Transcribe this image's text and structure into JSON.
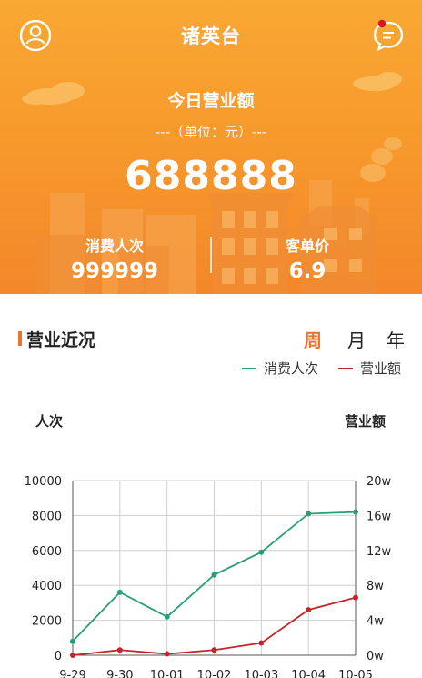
{
  "header": {
    "title": "诸英台"
  },
  "summary": {
    "revenue_label": "今日营业额",
    "unit_label": "---（单位：元）---",
    "revenue_value": "688888",
    "customers_label": "消费人次",
    "customers_value": "999999",
    "avg_price_label": "客单价",
    "avg_price_value": "6.9"
  },
  "section": {
    "title": "营业近况",
    "periods": [
      "周",
      "月",
      "年"
    ],
    "active_period": "周"
  },
  "colors": {
    "accent": "#f0732a",
    "series_customers": "#2a9d79",
    "series_revenue": "#c0262a"
  },
  "icons": {
    "profile": "user-circle-icon",
    "messages": "chat-bubble-icon"
  },
  "chart_data": {
    "type": "line",
    "x": [
      "9-29",
      "9-30",
      "10-01",
      "10-02",
      "10-03",
      "10-04",
      "10-05"
    ],
    "ylabel": "人次",
    "y2label": "营业额",
    "ylim": [
      0,
      10000
    ],
    "yticks": [
      0,
      2000,
      4000,
      6000,
      8000,
      10000
    ],
    "y2lim": [
      0,
      200000
    ],
    "y2ticks": [
      "0w",
      "4w",
      "8w",
      "12w",
      "16w",
      "20w"
    ],
    "legend_position": "top-right",
    "grid": true,
    "series": [
      {
        "name": "消费人次",
        "axis": "left",
        "values": [
          800,
          3600,
          2200,
          4600,
          5900,
          8100,
          8200
        ]
      },
      {
        "name": "营业额",
        "axis": "right",
        "values": [
          0,
          6000,
          1500,
          6000,
          14000,
          52000,
          66000
        ]
      }
    ]
  }
}
